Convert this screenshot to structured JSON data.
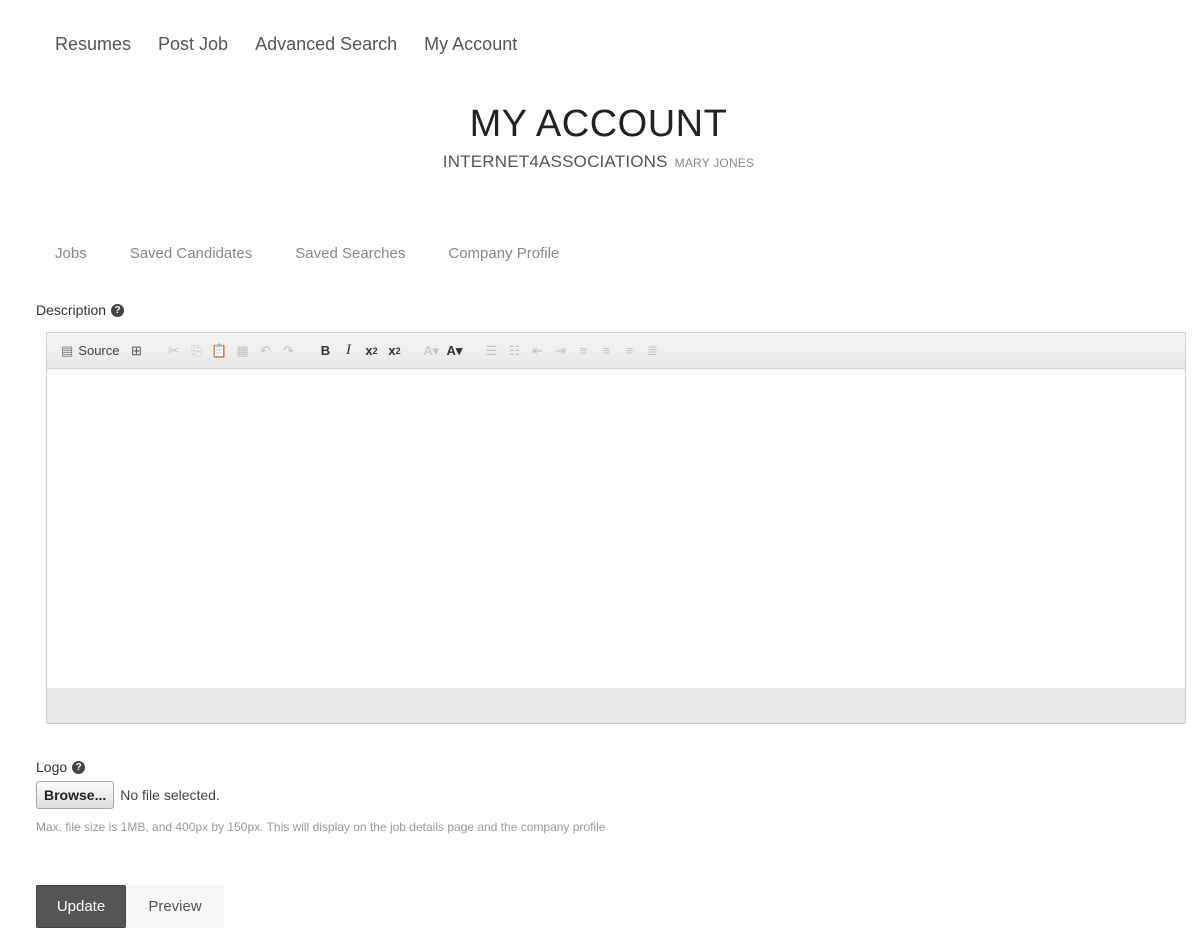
{
  "topnav": {
    "items": [
      {
        "label": "Resumes"
      },
      {
        "label": "Post Job"
      },
      {
        "label": "Advanced Search"
      },
      {
        "label": "My Account"
      }
    ]
  },
  "header": {
    "title": "MY ACCOUNT",
    "company": "INTERNET4ASSOCIATIONS",
    "user": "MARY JONES"
  },
  "tabs": [
    {
      "label": "Jobs"
    },
    {
      "label": "Saved Candidates"
    },
    {
      "label": "Saved Searches"
    },
    {
      "label": "Company Profile"
    }
  ],
  "description": {
    "label": "Description",
    "toolbar": {
      "source_label": "Source"
    }
  },
  "logo": {
    "label": "Logo",
    "browse_label": "Browse...",
    "file_status": "No file selected.",
    "help_text": "Max. file size is 1MB, and 400px by 150px. This will display on the job details page and the company profile"
  },
  "actions": {
    "update_label": "Update",
    "preview_label": "Preview"
  },
  "icons": {
    "help": "question-circle-icon"
  }
}
